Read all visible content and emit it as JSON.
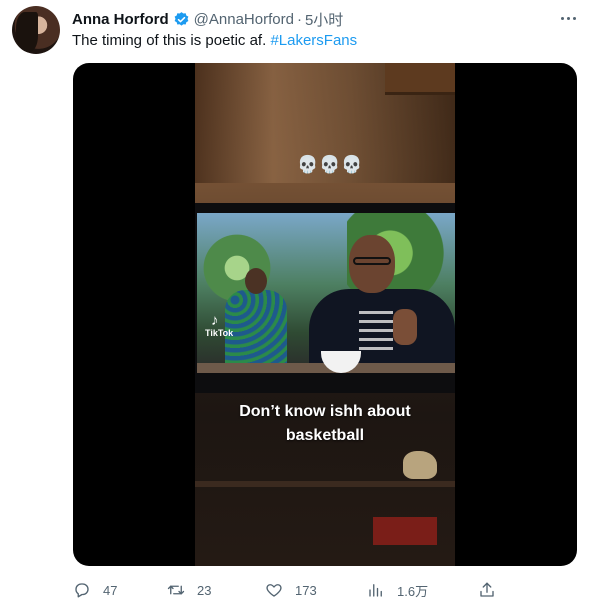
{
  "tweet": {
    "author_name": "Anna Horford",
    "handle": "@AnnaHorford",
    "separator": "·",
    "timestamp": "5小时",
    "text": "The timing of this is poetic af.",
    "hashtag": "#LakersFans"
  },
  "media": {
    "skulls": "💀💀💀",
    "tiktok_label": "TikTok",
    "tiktok_note": "♪",
    "caption_line1": "Don’t know ishh about",
    "caption_line2": "basketball"
  },
  "actions": {
    "replies": "47",
    "retweets": "23",
    "likes": "173",
    "views": "1.6万"
  },
  "colors": {
    "accent": "#1d9bf0",
    "muted": "#536471",
    "text": "#0f1419"
  }
}
